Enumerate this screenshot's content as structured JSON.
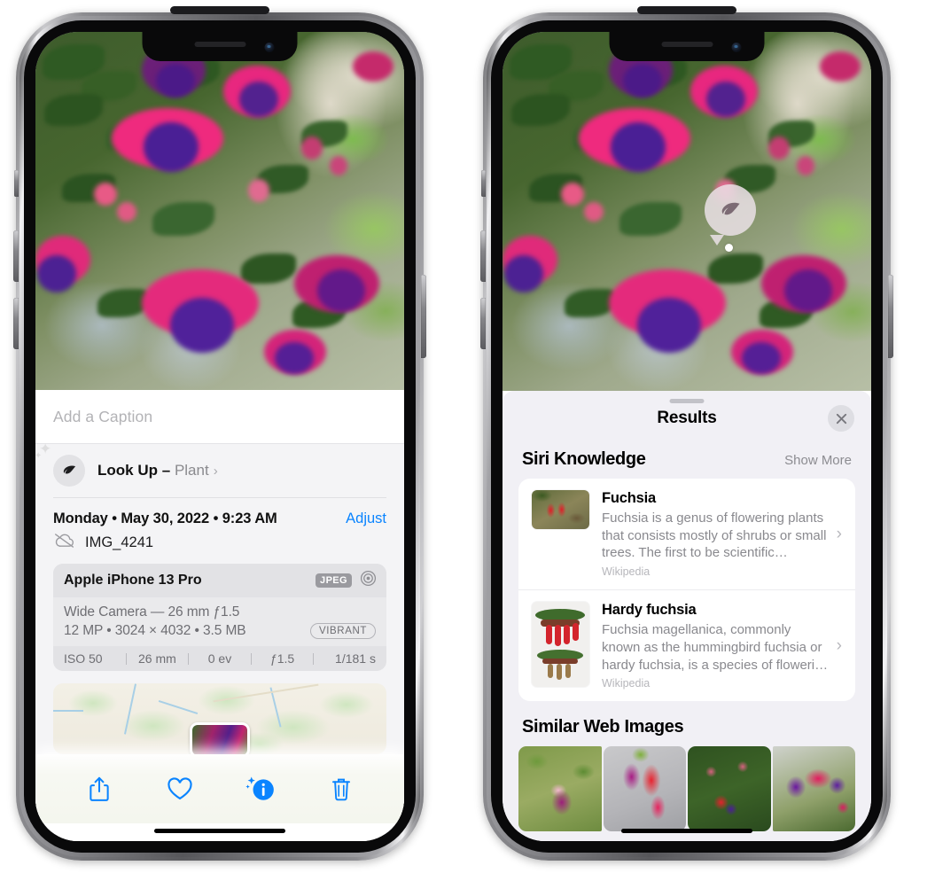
{
  "left_phone": {
    "caption_field": {
      "placeholder": "Add a Caption",
      "value": ""
    },
    "look_up": {
      "label": "Look Up",
      "dash": "–",
      "kind": "Plant",
      "chevron": "›",
      "icon": "leaf-icon"
    },
    "meta": {
      "date": "Monday • May 30, 2022 • 9:23 AM",
      "adjust_label": "Adjust",
      "filename": "IMG_4241",
      "cloud_icon": "icloud-slash-icon"
    },
    "camera_card": {
      "device": "Apple iPhone 13 Pro",
      "format_badge": "JPEG",
      "raw_icon": "aperture-icon",
      "lens_line": "Wide Camera — 26 mm ƒ1.5",
      "spec_line": "12 MP • 3024 × 4032 • 3.5 MB",
      "style_badge": "VIBRANT",
      "exif": [
        "ISO 50",
        "26 mm",
        "0 ev",
        "ƒ1.5",
        "1/181 s"
      ]
    },
    "map": {
      "pin_label": "photo-thumbnail-pin"
    },
    "toolbar": [
      {
        "name": "share-button",
        "icon": "share-icon"
      },
      {
        "name": "favorite-button",
        "icon": "heart-icon"
      },
      {
        "name": "info-button",
        "icon": "info-sparkle-icon"
      },
      {
        "name": "delete-button",
        "icon": "trash-icon"
      }
    ]
  },
  "right_phone": {
    "visual_lookup_badge": {
      "icon": "leaf-icon"
    },
    "results": {
      "title": "Results",
      "close_icon": "close-icon",
      "siri_knowledge": {
        "heading": "Siri Knowledge",
        "action": "Show More",
        "items": [
          {
            "title": "Fuchsia",
            "description": "Fuchsia is a genus of flowering plants that consists mostly of shrubs or small trees. The first to be scientific…",
            "source": "Wikipedia",
            "chevron": "›"
          },
          {
            "title": "Hardy fuchsia",
            "description": "Fuchsia magellanica, commonly known as the hummingbird fuchsia or hardy fuchsia, is a species of floweri…",
            "source": "Wikipedia",
            "chevron": "›"
          }
        ]
      },
      "similar_web_images": {
        "heading": "Similar Web Images",
        "count": 4
      }
    }
  },
  "colors": {
    "accent_blue": "#0a84ff",
    "sheet_bg": "#f1f0f5",
    "card_bg": "#ffffff",
    "secondary_text": "#8a8a8e",
    "badge_gray": "#9a9a9f"
  }
}
